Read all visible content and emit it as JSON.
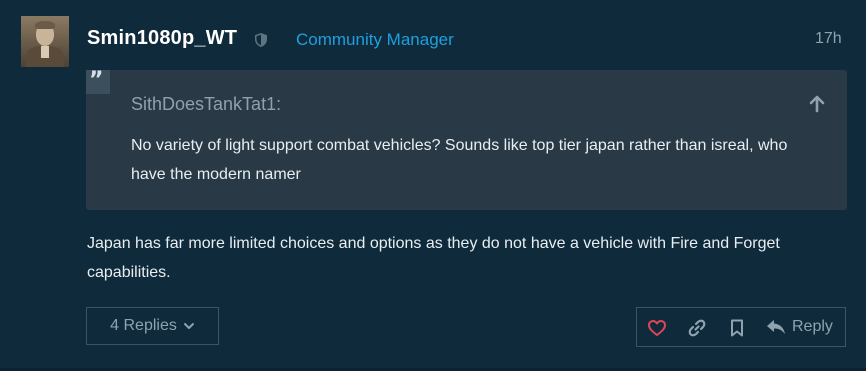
{
  "post": {
    "username": "Smin1080p_WT",
    "user_title": "Community Manager",
    "time": "17h",
    "body": "Japan has far more limited choices and options as they do not have a vehicle with Fire and Forget capabilities."
  },
  "quote": {
    "author": "SithDoesTankTat1:",
    "text": "No variety of light support combat vehicles? Sounds like top tier japan rather than isreal, who have the modern namer"
  },
  "footer": {
    "replies_label": "4 Replies",
    "reply_label": "Reply"
  },
  "colors": {
    "background": "#0f2a3a",
    "accent": "#1e9fe0",
    "like_heart": "#e0455a",
    "quote_bg": "#293a46"
  },
  "icons": [
    "shield-icon",
    "quote-icon",
    "arrow-up-icon",
    "chevron-down-icon",
    "heart-icon",
    "link-icon",
    "bookmark-icon",
    "reply-arrow-icon"
  ]
}
